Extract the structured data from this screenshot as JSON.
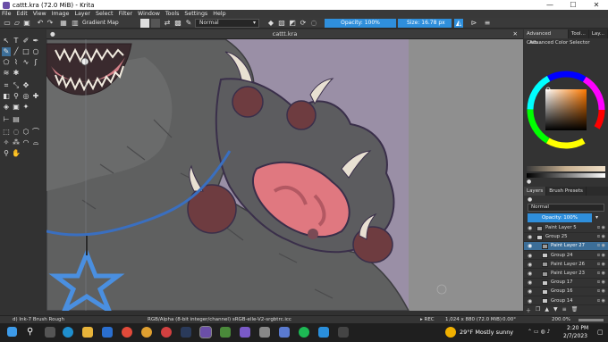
{
  "window": {
    "title": "cattt.kra (72.0 MiB) - Krita",
    "minimize": "—",
    "maximize": "☐",
    "close": "✕"
  },
  "menu": [
    "File",
    "Edit",
    "View",
    "Image",
    "Layer",
    "Select",
    "Filter",
    "Window",
    "Tools",
    "Settings",
    "Help"
  ],
  "tool_options": {
    "gradient_label": "Gradient Map",
    "blend_mode": "Normal",
    "opacity": "Opacity: 100%",
    "size": "Size: 16.78 px"
  },
  "document": {
    "tab_title": "cattt.kra"
  },
  "dock": {
    "top_tabs": [
      "Advanced Colo...",
      "Tool...",
      "Lay..."
    ],
    "color_selector_title": "Advanced Color Selector",
    "bottom_tabs": [
      "Layers",
      "Brush Presets"
    ],
    "layer_blend": "Normal",
    "layer_opacity": "Opacity: 100%",
    "layers": [
      {
        "name": "Paint Layer 5",
        "selected": false,
        "group": false,
        "indent": 0
      },
      {
        "name": "Group 25",
        "selected": false,
        "group": true,
        "indent": 0
      },
      {
        "name": "Paint Layer 27",
        "selected": true,
        "group": false,
        "indent": 1
      },
      {
        "name": "Group 24",
        "selected": false,
        "group": true,
        "indent": 1
      },
      {
        "name": "Paint Layer 26",
        "selected": false,
        "group": false,
        "indent": 1
      },
      {
        "name": "Paint Layer 23",
        "selected": false,
        "group": false,
        "indent": 1
      },
      {
        "name": "Group 17",
        "selected": false,
        "group": true,
        "indent": 1
      },
      {
        "name": "Group 16",
        "selected": false,
        "group": true,
        "indent": 1
      },
      {
        "name": "Group 14",
        "selected": false,
        "group": true,
        "indent": 1
      }
    ]
  },
  "status": {
    "brush": "d) Ink-7 Brush Rough",
    "color_space": "RGB/Alpha (8-bit integer/channel)  sRGB-elle-V2-srgbtrc.icc",
    "rec": "REC",
    "dimensions": "1,024 x 880 (72.0 MiB)",
    "rotation": "0.00°",
    "zoom": "200.0%"
  },
  "taskbar": {
    "weather": "29°F  Mostly sunny",
    "time": "2:20 PM",
    "date": "2/7/2023"
  },
  "colors": {
    "accent": "#2f8fdc",
    "layer_selected": "#3c6e98",
    "canvas_bg": "#8c8394",
    "fur": "#5f6060",
    "pad": "#e07880",
    "claw": "#e8e0d2",
    "necklace": "#4a8fe0"
  }
}
